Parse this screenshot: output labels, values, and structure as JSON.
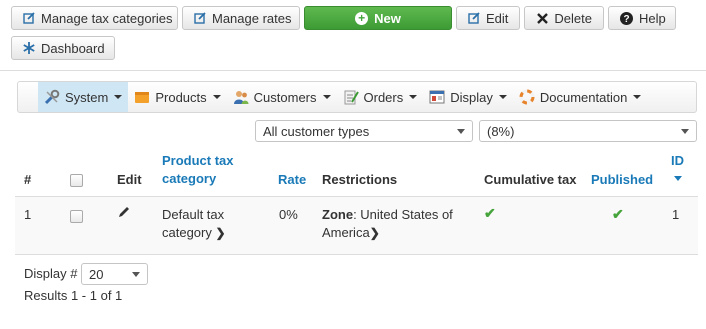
{
  "toolbar": {
    "manage_tax_categories": "Manage tax categories",
    "manage_rates": "Manage rates",
    "new": "New",
    "edit": "Edit",
    "delete": "Delete",
    "help": "Help",
    "dashboard": "Dashboard"
  },
  "menu": {
    "system": "System",
    "products": "Products",
    "customers": "Customers",
    "orders": "Orders",
    "display": "Display",
    "documentation": "Documentation"
  },
  "filters": {
    "customer_type": "All customer types",
    "rate": "(8%)"
  },
  "table": {
    "headers": {
      "num": "#",
      "edit": "Edit",
      "product_tax_category_line1": "Product tax",
      "product_tax_category_line2": "category",
      "rate": "Rate",
      "restrictions": "Restrictions",
      "cumulative_tax": "Cumulative tax",
      "published": "Published",
      "id": "ID"
    },
    "rows": [
      {
        "num": "1",
        "category_line1": "Default tax",
        "category_line2": "category",
        "rate": "0%",
        "restriction_label": "Zone",
        "restriction_value_line1": ": United States of",
        "restriction_value_line2": "America",
        "cumulative": true,
        "published": true,
        "id": "1"
      }
    ]
  },
  "footer": {
    "display_label": "Display #",
    "display_value": "20",
    "results": "Results 1 - 1 of 1"
  },
  "colors": {
    "accent": "#1a7ab8",
    "new_button": "#46a43c",
    "check": "#46a43c"
  }
}
